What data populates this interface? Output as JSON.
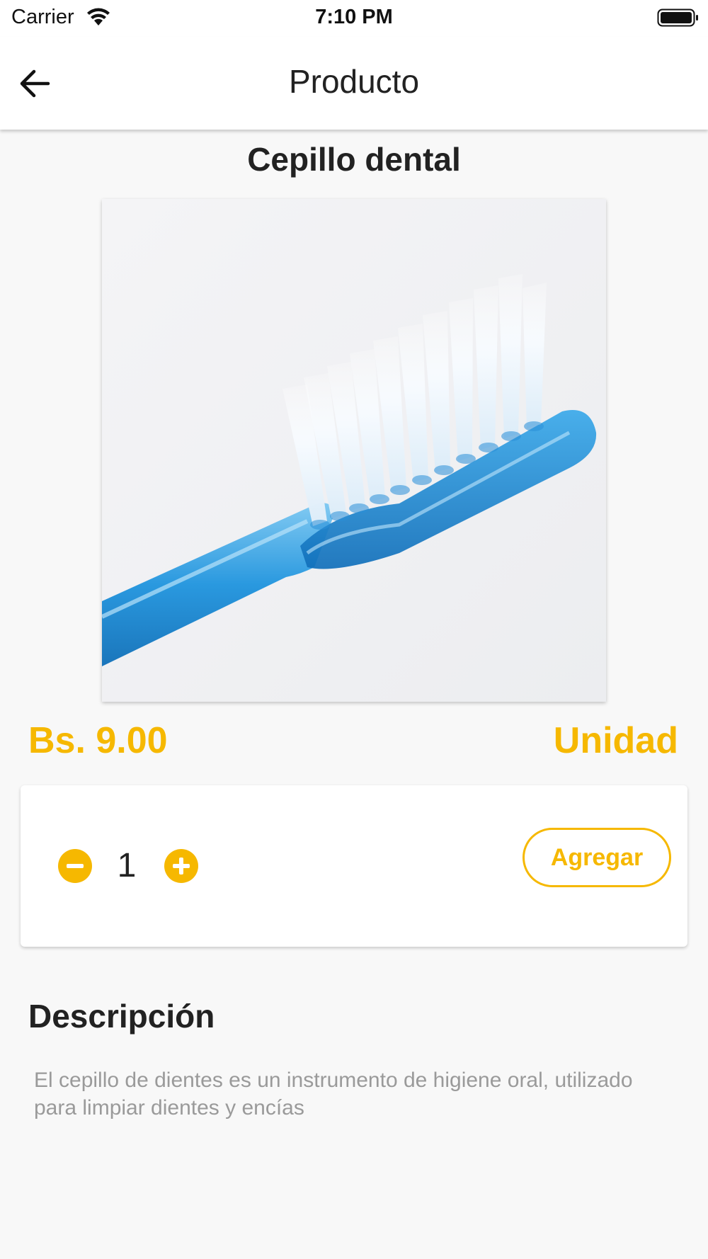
{
  "status_bar": {
    "carrier": "Carrier",
    "time": "7:10 PM"
  },
  "nav": {
    "title": "Producto",
    "back_icon": "arrow-left-icon"
  },
  "product": {
    "name": "Cepillo dental",
    "image_icon": "toothbrush-image",
    "price": "Bs. 9.00",
    "unit": "Unidad"
  },
  "quantity": {
    "value": "1",
    "decrement_icon": "minus-circle-icon",
    "increment_icon": "plus-circle-icon",
    "add_label": "Agregar"
  },
  "description": {
    "heading": "Descripción",
    "text": "El cepillo de dientes es un instrumento de higiene oral, utilizado para limpiar dientes y encías"
  },
  "colors": {
    "accent": "#f6b800",
    "background": "#f8f8f8",
    "text": "#222222",
    "muted_text": "#9a9a9a"
  }
}
